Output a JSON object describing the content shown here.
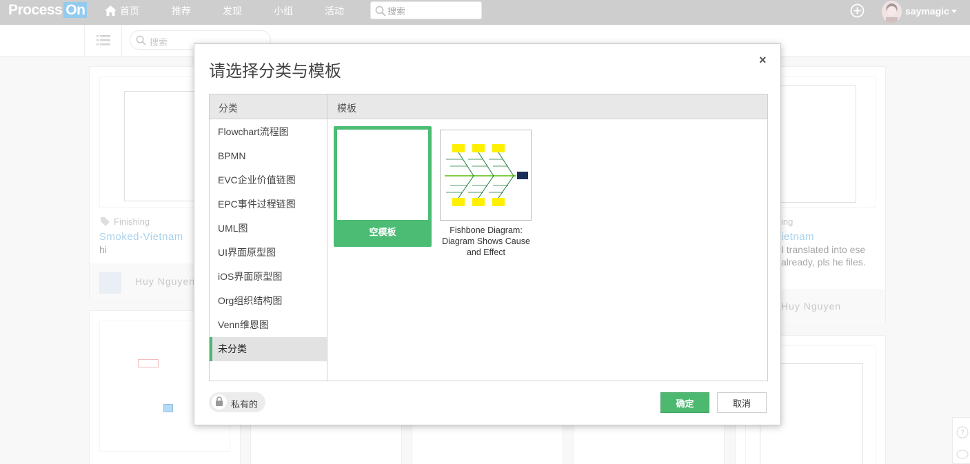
{
  "app": {
    "logo_main": "Process",
    "logo_accent": "On"
  },
  "nav": {
    "items": [
      {
        "label": "首页"
      },
      {
        "label": "推荐"
      },
      {
        "label": "发现"
      },
      {
        "label": "小组"
      },
      {
        "label": "活动"
      }
    ],
    "search_placeholder": "搜索",
    "username": "saymagic"
  },
  "toolbar": {
    "search_placeholder": "搜索"
  },
  "cards": [
    {
      "tag": "Finishing",
      "title": "Smoked-Vietnam",
      "desc": "hi",
      "author": "Huy Nguyen"
    },
    {
      "tag": "ing",
      "title": "ietnam",
      "desc": "I translated into ese already, pls he files.",
      "author": "Huy Nguyen"
    }
  ],
  "dialog": {
    "title": "请选择分类与模板",
    "close": "×",
    "category_header": "分类",
    "template_header": "模板",
    "categories": [
      {
        "label": "Flowchart流程图"
      },
      {
        "label": "BPMN"
      },
      {
        "label": "EVC企业价值链图"
      },
      {
        "label": "EPC事件过程链图"
      },
      {
        "label": "UML图"
      },
      {
        "label": "UI界面原型图"
      },
      {
        "label": "iOS界面原型图"
      },
      {
        "label": "Org组织结构图"
      },
      {
        "label": "Venn维恩图"
      },
      {
        "label": "未分类"
      }
    ],
    "selected_category": "未分类",
    "templates": [
      {
        "label": "空模板",
        "selected": true
      },
      {
        "label": "Fishbone Diagram: Diagram Shows Cause and Effect",
        "selected": false
      }
    ],
    "private_label": "私有的",
    "ok_label": "确定",
    "cancel_label": "取消"
  },
  "colors": {
    "accent_green": "#4cb870",
    "topbar": "#b4b4b4",
    "link_blue": "#7ab8e0"
  }
}
